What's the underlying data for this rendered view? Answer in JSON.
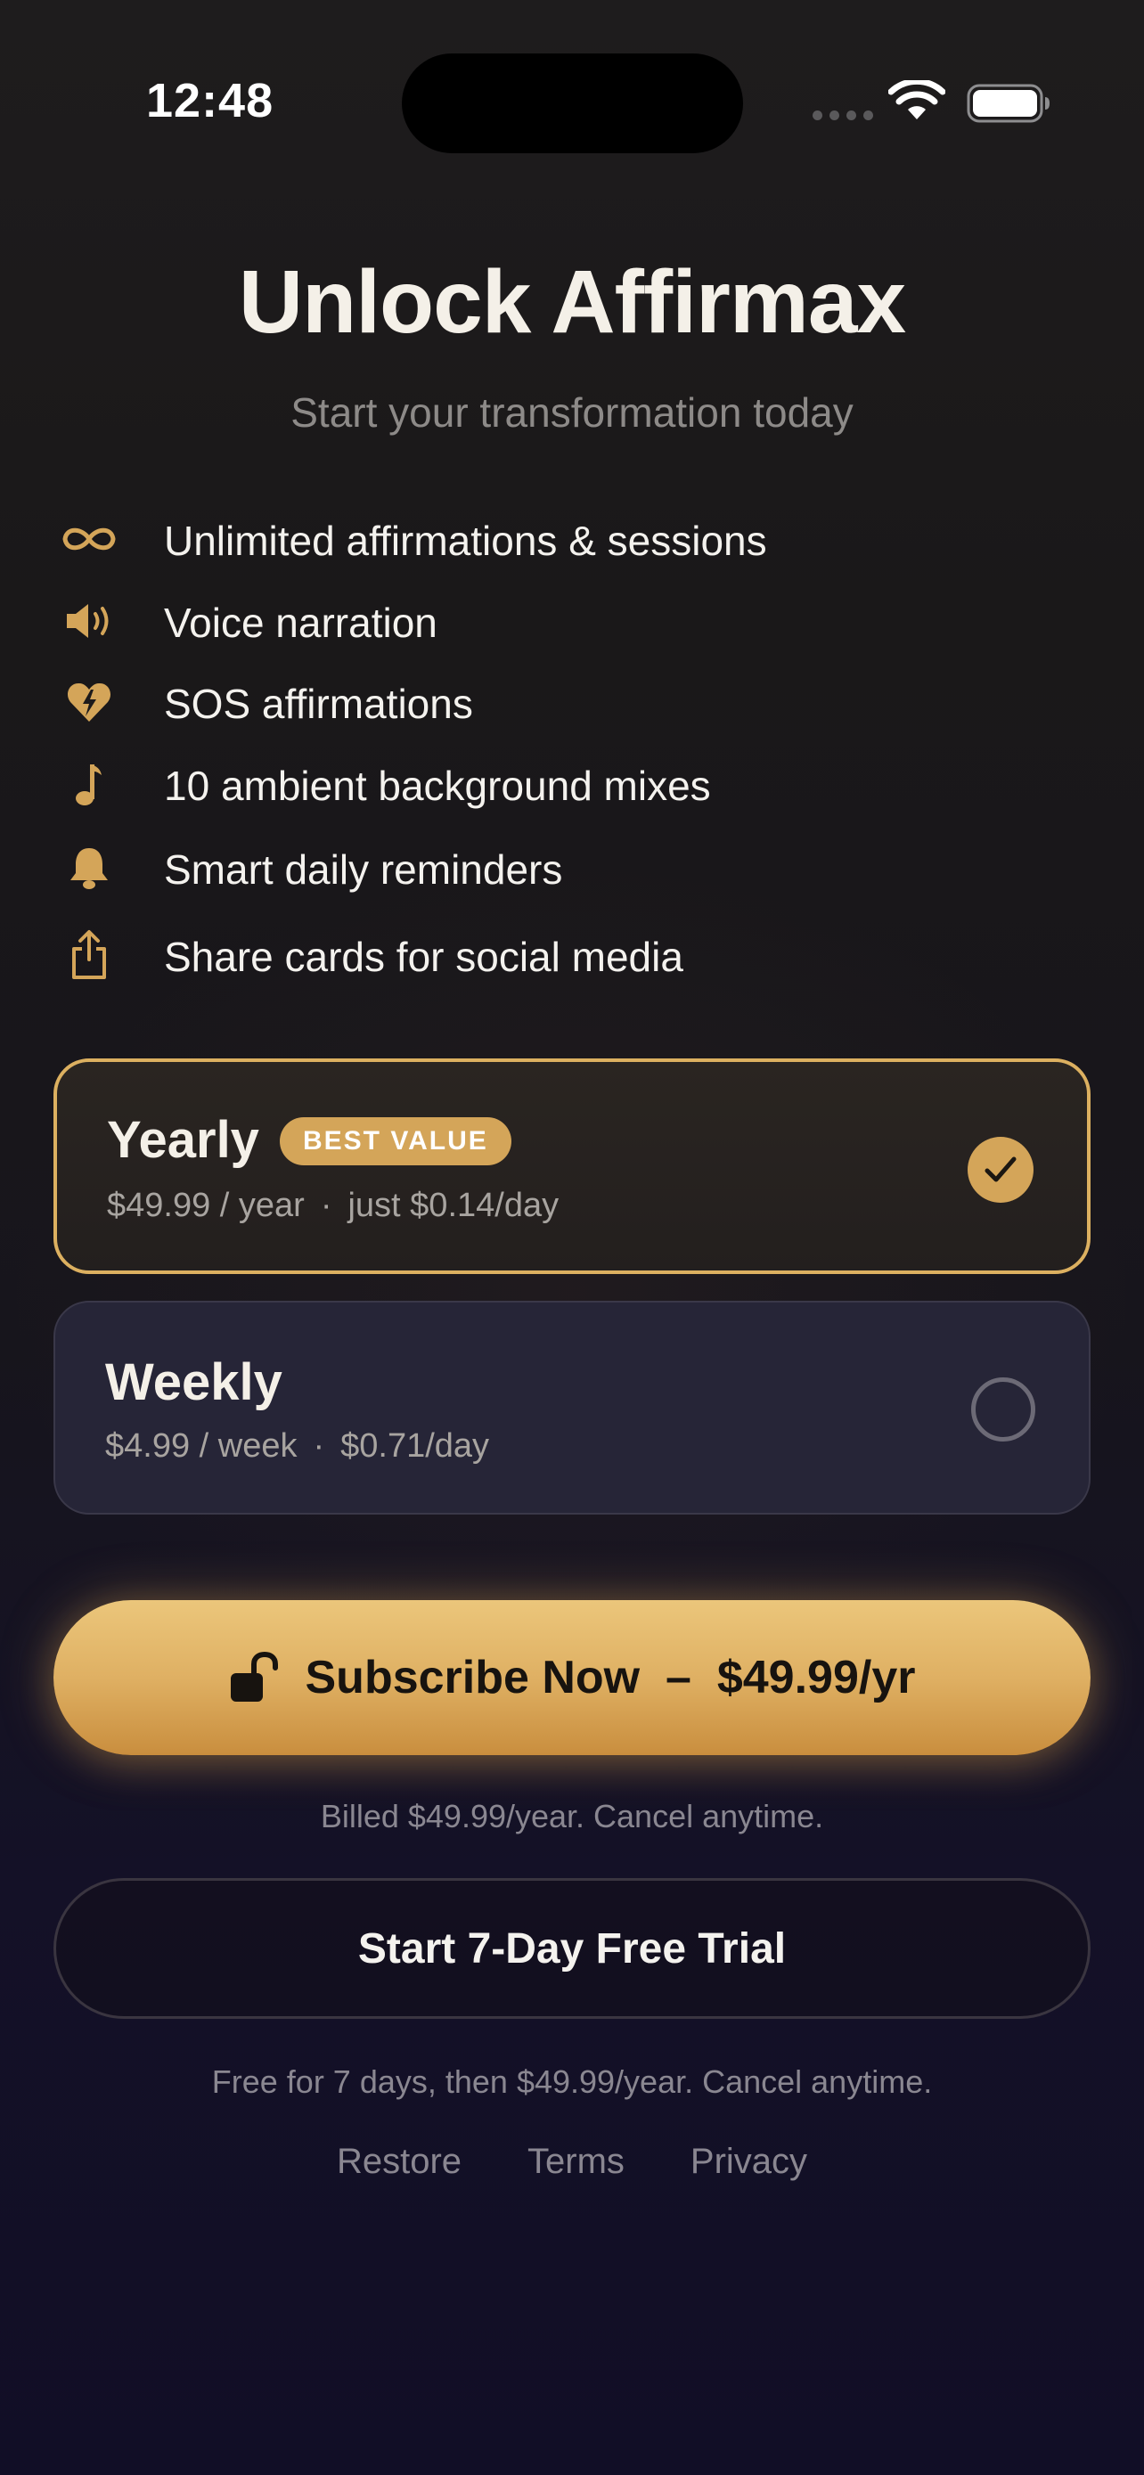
{
  "status_bar": {
    "time": "12:48"
  },
  "header": {
    "title": "Unlock Affirmax",
    "subtitle": "Start your transformation today"
  },
  "features": [
    {
      "icon": "infinity-icon",
      "label": "Unlimited affirmations & sessions"
    },
    {
      "icon": "speaker-icon",
      "label": "Voice narration"
    },
    {
      "icon": "heart-bolt-icon",
      "label": "SOS affirmations"
    },
    {
      "icon": "music-note-icon",
      "label": "10 ambient background mixes"
    },
    {
      "icon": "bell-icon",
      "label": "Smart daily reminders"
    },
    {
      "icon": "share-icon",
      "label": "Share cards for social media"
    }
  ],
  "plans": {
    "yearly": {
      "name": "Yearly",
      "badge": "BEST VALUE",
      "price": "$49.99 / year",
      "per_day": "just $0.14/day",
      "selected": true
    },
    "weekly": {
      "name": "Weekly",
      "price": "$4.99 / week",
      "per_day": "$0.71/day",
      "selected": false
    },
    "separator": "·"
  },
  "cta": {
    "subscribe_label": "Subscribe Now  –  $49.99/yr",
    "billed_note": "Billed $49.99/year. Cancel anytime.",
    "trial_label": "Start 7-Day Free Trial",
    "trial_note": "Free for 7 days, then $49.99/year. Cancel anytime."
  },
  "footer": {
    "restore": "Restore",
    "terms": "Terms",
    "privacy": "Privacy"
  },
  "colors": {
    "accent_gold": "#D4A559",
    "background_top": "#1E1C1D",
    "background_bottom": "#110E26",
    "weekly_card": "#262537"
  }
}
